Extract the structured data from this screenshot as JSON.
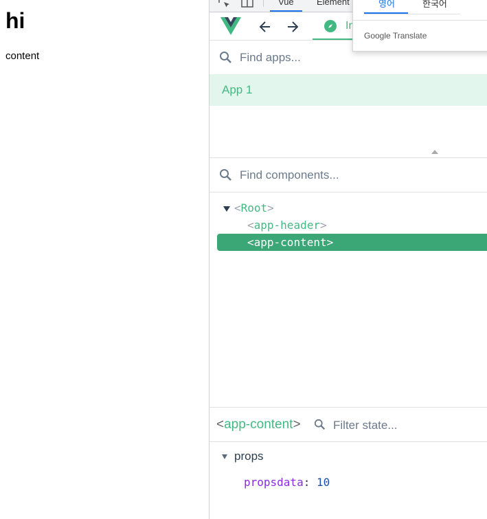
{
  "page": {
    "heading": "hi",
    "content": "content"
  },
  "devtools": {
    "tabs": [
      "Vue",
      "Element"
    ],
    "active_tab": "Vue",
    "inspector_tab_label": "In"
  },
  "apps": {
    "search_placeholder": "Find apps...",
    "items": [
      "App 1"
    ]
  },
  "components": {
    "search_placeholder": "Find components...",
    "tree": {
      "root": "Root",
      "children": [
        "app-header",
        "app-content"
      ],
      "selected": "app-content"
    }
  },
  "state": {
    "selected_component": "app-content",
    "filter_placeholder": "Filter state...",
    "section": "props",
    "prop_name": "propsdata",
    "prop_sep": ":",
    "prop_value": "10"
  },
  "translate_popup": {
    "tabs": [
      "영어",
      "한국어"
    ],
    "active": "영어",
    "brand_google": "Google",
    "brand_translate": "Translate"
  },
  "colors": {
    "vue_green": "#42b983",
    "selected_bg": "#3ba776",
    "app_row_bg": "#e2f6ee",
    "prop_key": "#8a2be2",
    "prop_num": "#1b4ea6"
  },
  "icons": [
    "inspect-icon",
    "device-toggle-icon",
    "vue-logo-icon",
    "back-arrow-icon",
    "forward-arrow-icon",
    "compass-icon",
    "search-icon"
  ]
}
